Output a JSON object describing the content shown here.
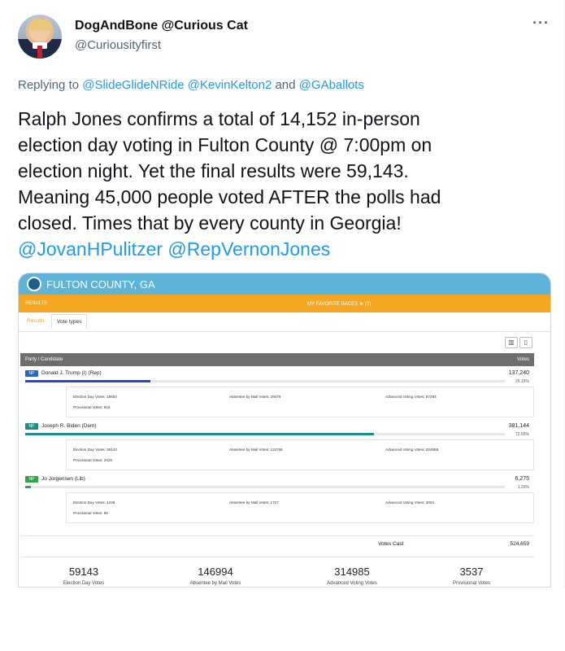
{
  "tweet": {
    "display_name": "DogAndBone @Curious Cat",
    "handle": "@Curiousityfirst",
    "more_icon": "more-dots-icon",
    "reply_prefix": "Replying to ",
    "reply_mentions": [
      "@SlideGlideNRide",
      "@KevinKelton2",
      "@GAballots"
    ],
    "reply_and": " and ",
    "text_lines": [
      "Ralph Jones confirms a total of 14,152 in-person",
      "election day voting in Fulton County @ 7:00pm on",
      "election night.  Yet the final results were 59,143.",
      "Meaning 45,000 people voted AFTER the polls had",
      "closed. Times that by every county in Georgia!"
    ],
    "text_mentions": [
      "@JovanHPulitzer",
      "@RepVernonJones"
    ]
  },
  "screenshot": {
    "county": "FULTON COUNTY, GA",
    "results_label": "RESULTS",
    "favorites_label": "MY FAVORITE RACES ★ (0)",
    "tabs": [
      "Results",
      "Vote types"
    ],
    "header_left": "Party / Candidate",
    "header_right": "Votes",
    "candidates": [
      {
        "badge": "NP",
        "name": "Donald J. Trump (I) (Rep)",
        "votes": "137,240",
        "pct": "26.16%",
        "pct_value": 26.16,
        "color": "#2a47c4",
        "badge_color": "#2a63c4",
        "election_day": "Election Day Votes: 18652",
        "provisional": "Provisional Votes: 916",
        "absentee": "Absentee by Mail Votes: 29479",
        "advanced": "Advanced Voting Votes: 87293"
      },
      {
        "badge": "NP",
        "name": "Joseph R. Biden (Dem)",
        "votes": "381,144",
        "pct": "72.65%",
        "pct_value": 72.65,
        "color": "#1f8f86",
        "badge_color": "#1f8f86",
        "election_day": "Election Day Votes: 38143",
        "provisional": "Provisional Votes: 2525",
        "absentee": "Absentee by Mail Votes: 115788",
        "advanced": "Advanced Voting Votes: 224688"
      },
      {
        "badge": "NP",
        "name": "Jo Jorgensen (Lib)",
        "votes": "6,275",
        "pct": "1.20%",
        "pct_value": 1.2,
        "color": "#2aa84a",
        "badge_color": "#2aa84a",
        "election_day": "Election Day Votes: 1448",
        "provisional": "Provisional Votes: 96",
        "absentee": "Absentee by Mail Votes: 1727",
        "advanced": "Advanced Voting Votes: 3004"
      }
    ],
    "votes_cast_label": "Votes Cast",
    "votes_cast": "524,659",
    "summary": [
      {
        "value": "59143",
        "label": "Election Day Votes"
      },
      {
        "value": "146994",
        "label": "Absentee by Mail Votes"
      },
      {
        "value": "314985",
        "label": "Advanced Voting Votes"
      },
      {
        "value": "3537",
        "label": "Provisional Votes"
      }
    ]
  },
  "colors": {
    "link": "#1d9bf0",
    "county_bar": "#5db4d8",
    "orange_bar": "#f5a623"
  }
}
